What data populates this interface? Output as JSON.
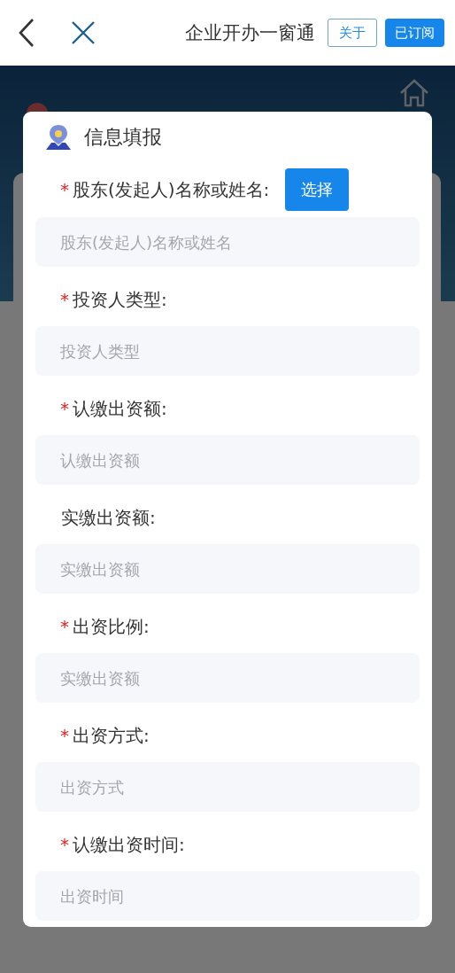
{
  "header": {
    "title": "企业开办一窗通",
    "about_button": "关于",
    "subscribe_button": "已订阅"
  },
  "dialog": {
    "title": "信息填报",
    "fields": [
      {
        "label": "股东(发起人)名称或姓名:",
        "required_mark": "*",
        "placeholder": "股东(发起人)名称或姓名",
        "button": "选择"
      },
      {
        "label": "投资人类型:",
        "required_mark": "*",
        "placeholder": "投资人类型"
      },
      {
        "label": "认缴出资额:",
        "required_mark": "*",
        "placeholder": "认缴出资额"
      },
      {
        "label": "实缴出资额:",
        "placeholder": "实缴出资额"
      },
      {
        "label": "出资比例:",
        "required_mark": "*",
        "placeholder": "实缴出资额"
      },
      {
        "label": "出资方式:",
        "required_mark": "*",
        "placeholder": "出资方式"
      },
      {
        "label": "认缴出资时间:",
        "required_mark": "*",
        "placeholder": "出资时间"
      }
    ]
  }
}
